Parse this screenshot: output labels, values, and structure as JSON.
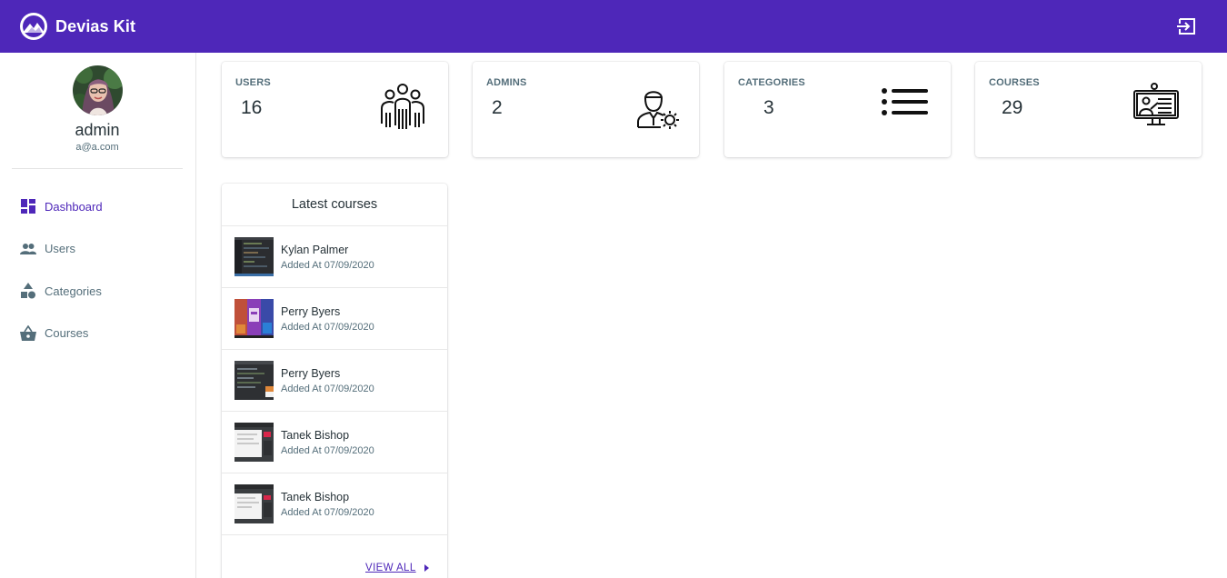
{
  "app": {
    "brand": "Devias Kit",
    "accent_color": "#4e27b9",
    "logout_icon": "logout-icon"
  },
  "sidebar": {
    "user_name": "admin",
    "user_email": "a@a.com",
    "items": [
      {
        "label": "Dashboard",
        "icon": "dashboard-icon",
        "active": true
      },
      {
        "label": "Users",
        "icon": "people-icon",
        "active": false
      },
      {
        "label": "Categories",
        "icon": "category-icon",
        "active": false
      },
      {
        "label": "Courses",
        "icon": "basket-icon",
        "active": false
      }
    ]
  },
  "stats": [
    {
      "label": "USERS",
      "value": "16",
      "icon": "users-group-icon"
    },
    {
      "label": "ADMINS",
      "value": "2",
      "icon": "admin-gear-icon"
    },
    {
      "label": "CATEGORIES",
      "value": "3",
      "icon": "list-icon"
    },
    {
      "label": "COURSES",
      "value": "29",
      "icon": "online-course-icon"
    }
  ],
  "latest_courses": {
    "title": "Latest courses",
    "items": [
      {
        "name": "Kylan Palmer",
        "date": "Added At 07/09/2020"
      },
      {
        "name": "Perry Byers",
        "date": "Added At 07/09/2020"
      },
      {
        "name": "Perry Byers",
        "date": "Added At 07/09/2020"
      },
      {
        "name": "Tanek Bishop",
        "date": "Added At 07/09/2020"
      },
      {
        "name": "Tanek Bishop",
        "date": "Added At 07/09/2020"
      }
    ],
    "view_all": "VIEW ALL"
  }
}
